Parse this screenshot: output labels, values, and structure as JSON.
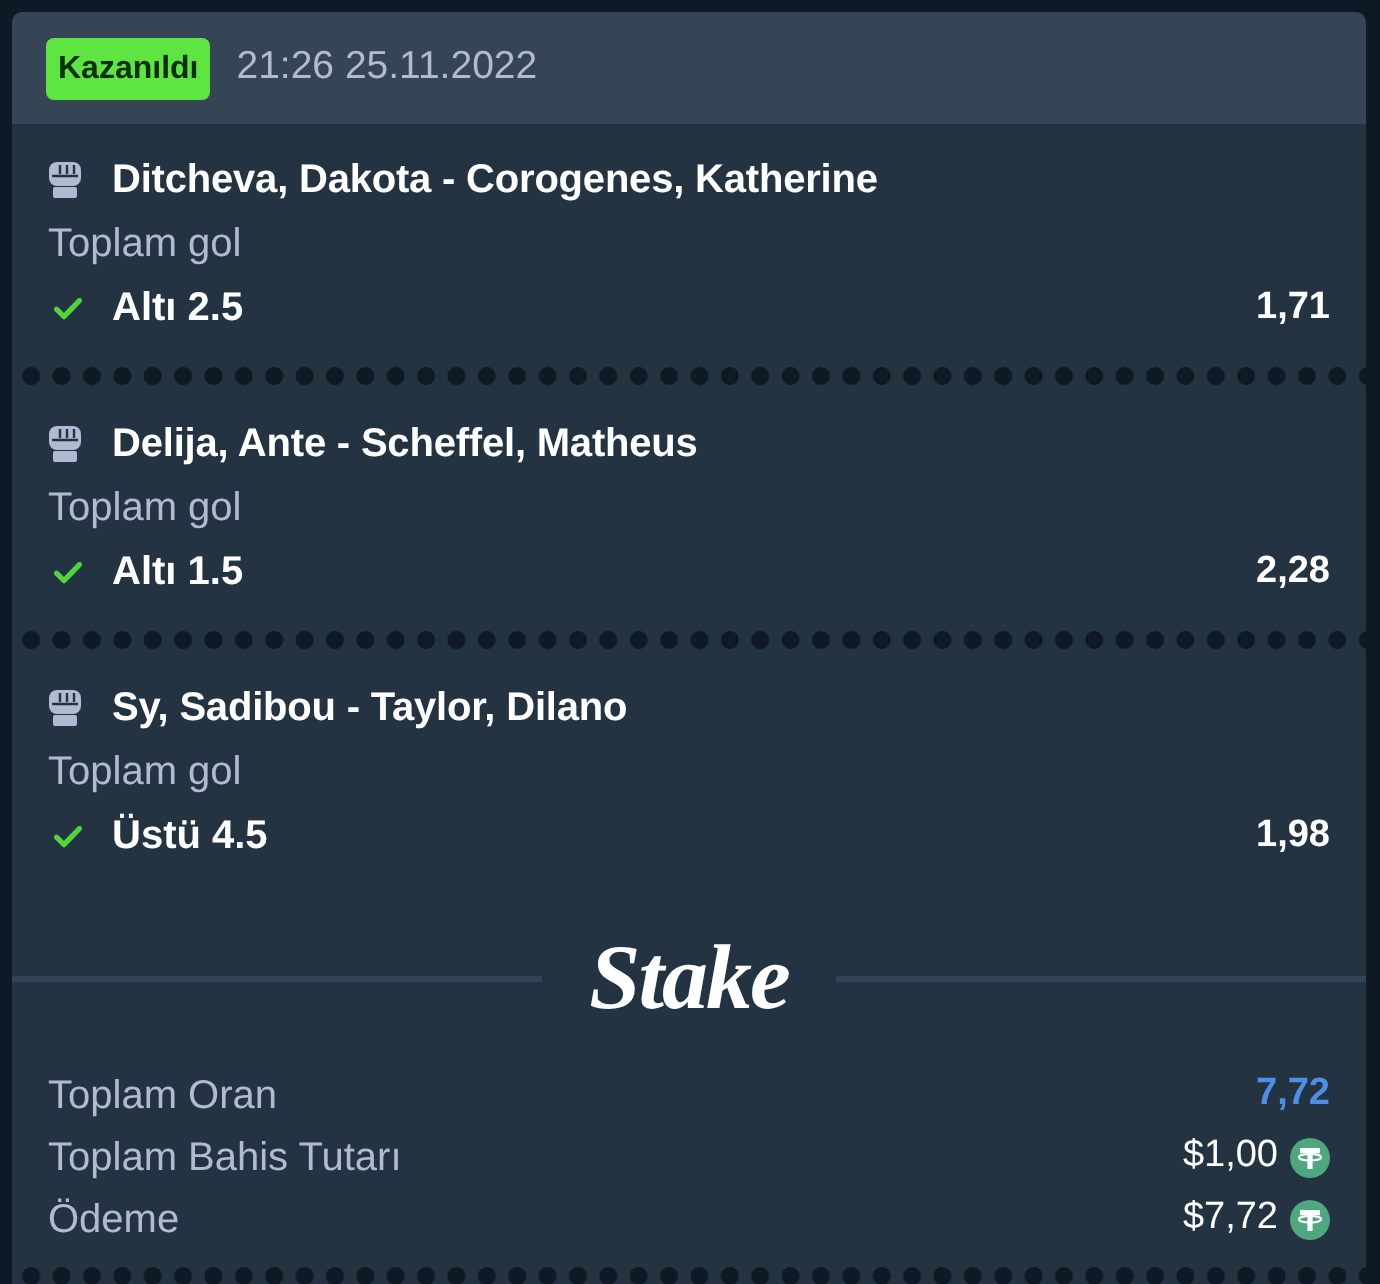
{
  "header": {
    "status": {
      "label": "Kazanıldı",
      "kind": "won"
    },
    "datetime": "21:26 25.11.2022"
  },
  "bets": [
    {
      "event": "Ditcheva, Dakota - Corogenes, Katherine",
      "market": "Toplam gol",
      "selection": "Altı 2.5",
      "odds": "1,71",
      "won": true
    },
    {
      "event": "Delija, Ante - Scheffel, Matheus",
      "market": "Toplam gol",
      "selection": "Altı 1.5",
      "odds": "2,28",
      "won": true
    },
    {
      "event": "Sy, Sadibou - Taylor, Dilano",
      "market": "Toplam gol",
      "selection": "Üstü 4.5",
      "odds": "1,98",
      "won": true
    }
  ],
  "logo": {
    "text": "Stake"
  },
  "summary": [
    {
      "label": "Toplam Oran",
      "value": "7,72",
      "kind": "odds"
    },
    {
      "label": "Toplam Bahis Tutarı",
      "value": "$1,00",
      "kind": "amount"
    },
    {
      "label": "Ödeme",
      "value": "$7,72",
      "kind": "amount"
    }
  ]
}
